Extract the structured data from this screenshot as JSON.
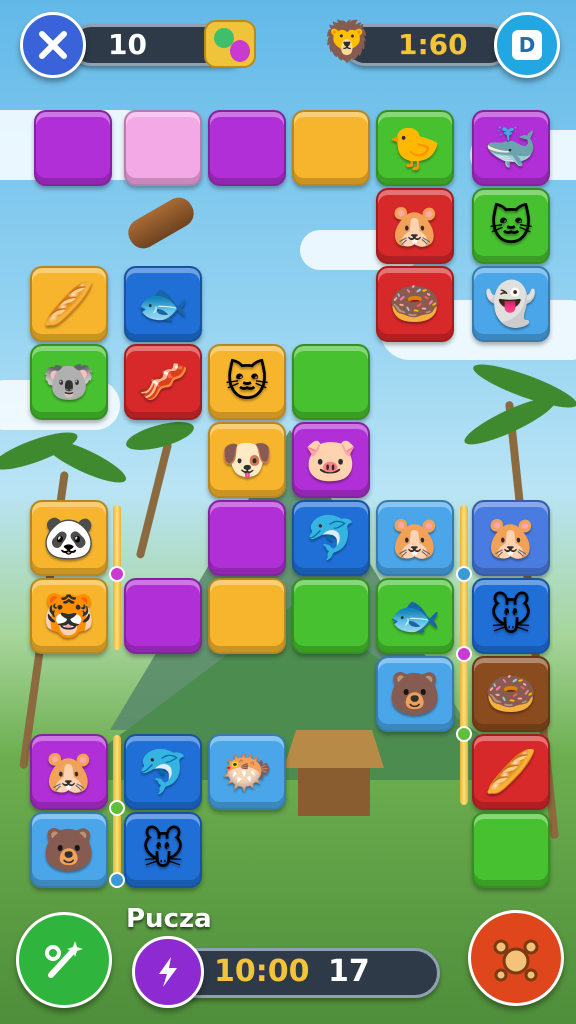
{
  "hud": {
    "close_icon": "close-icon",
    "moves_value": "10",
    "balloon_icon": "balloon-icon",
    "timer_value": "1:60",
    "avatar_icon": "fox-avatar-icon",
    "badge_label": "D"
  },
  "board": {
    "tiles": [
      {
        "color": "#b12fd6",
        "animal": ""
      },
      {
        "color": "#f3a9e6",
        "animal": ""
      },
      {
        "color": "#b12fd6",
        "animal": ""
      },
      {
        "color": "#f6b52c",
        "animal": ""
      },
      {
        "color": "#47c12f",
        "animal": "🐤"
      },
      {
        "color": "#b12fd6",
        "animal": "🐳"
      },
      {
        "color": "#d7282a",
        "animal": "🐹"
      },
      {
        "color": "#47c12f",
        "animal": "🐱"
      },
      {
        "color": "#f6b52c",
        "animal": "🥖"
      },
      {
        "color": "#1f6fd6",
        "animal": "🐟"
      },
      {
        "color": "#d7282a",
        "animal": "🍩"
      },
      {
        "color": "#4aa6e8",
        "animal": "👻"
      },
      {
        "color": "#47c12f",
        "animal": "🐨"
      },
      {
        "color": "#d7282a",
        "animal": "🥓"
      },
      {
        "color": "#f6b52c",
        "animal": "🐱"
      },
      {
        "color": "#47c12f",
        "animal": ""
      },
      {
        "color": "#f6b52c",
        "animal": "🐶"
      },
      {
        "color": "#b12fd6",
        "animal": "🐷"
      },
      {
        "color": "#f6b52c",
        "animal": "🐼"
      },
      {
        "color": "#b12fd6",
        "animal": ""
      },
      {
        "color": "#1f6fd6",
        "animal": "🐬"
      },
      {
        "color": "#4aa6e8",
        "animal": "🐹"
      },
      {
        "color": "#4a7be0",
        "animal": "🐹"
      },
      {
        "color": "#f6b52c",
        "animal": "🐯"
      },
      {
        "color": "#b12fd6",
        "animal": ""
      },
      {
        "color": "#f6b52c",
        "animal": ""
      },
      {
        "color": "#47c12f",
        "animal": ""
      },
      {
        "color": "#47c12f",
        "animal": "🐟"
      },
      {
        "color": "#1f6fd6",
        "animal": "🐭"
      },
      {
        "color": "#4aa6e8",
        "animal": "🐻"
      },
      {
        "color": "#8a4b1e",
        "animal": "🍩"
      },
      {
        "color": "#b12fd6",
        "animal": "🐹"
      },
      {
        "color": "#1f6fd6",
        "animal": "🐬"
      },
      {
        "color": "#4aa6e8",
        "animal": "🐡"
      },
      {
        "color": "#d7282a",
        "animal": "🥖"
      },
      {
        "color": "#4aa6e8",
        "animal": "🐻"
      },
      {
        "color": "#1f6fd6",
        "animal": "🐭"
      },
      {
        "color": "#47c12f",
        "animal": ""
      }
    ],
    "log_icon": "wood-log-icon"
  },
  "bottom_bar": {
    "player_name": "Pucza",
    "time_value": "10:00",
    "count_value": "17",
    "left_button_icon": "wand-sparkle-icon",
    "center_icon": "lightning-icon",
    "right_button_icon": "paw-icon"
  },
  "colors": {
    "hud_dark": "#2e3a48",
    "close_button": "#3b63d9",
    "badge_button": "#23a7e2",
    "left_button": "#2fb53d",
    "right_button": "#e0461c",
    "center_button": "#8e2ad2",
    "timer_text": "#f3c33a"
  }
}
